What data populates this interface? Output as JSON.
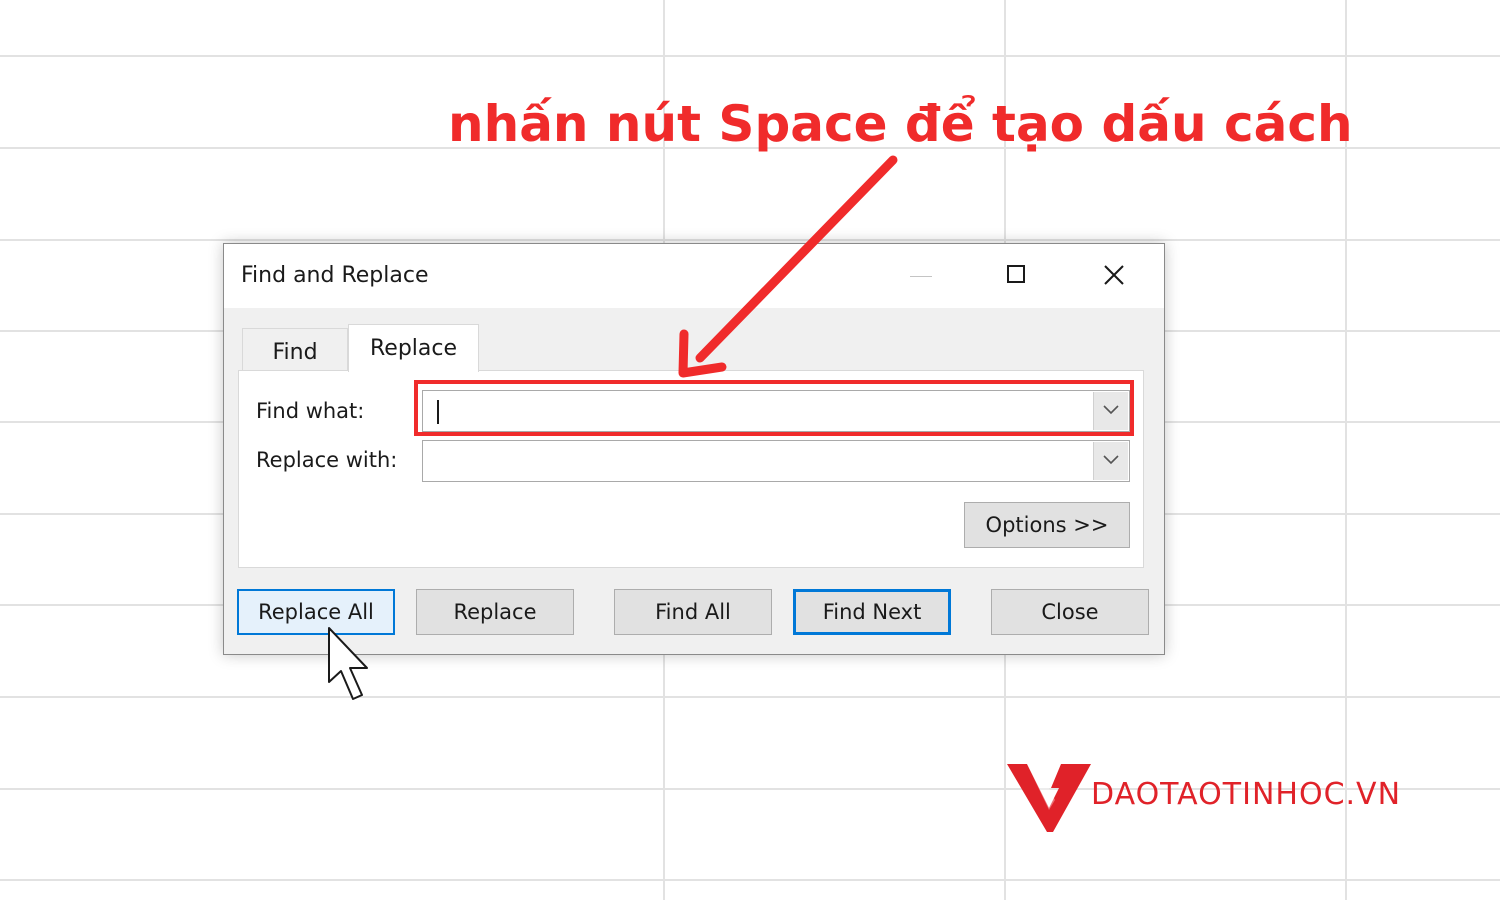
{
  "annotation": {
    "text": "nhấn nút Space để tạo dấu cách",
    "color": "#f02b2b"
  },
  "dialog": {
    "title": "Find and Replace",
    "titlebar_buttons": {
      "minimize_icon": "minimize-icon",
      "maximize_icon": "maximize-icon",
      "close_icon": "close-icon"
    },
    "tabs": [
      {
        "label": "Find",
        "selected": false
      },
      {
        "label": "Replace",
        "selected": true
      }
    ],
    "find_what": {
      "label": "Find what:",
      "value": ""
    },
    "replace_with": {
      "label": "Replace with:",
      "value": ""
    },
    "options_label": "Options >>",
    "buttons": {
      "replace_all": "Replace All",
      "replace": "Replace",
      "find_all": "Find All",
      "find_next": "Find Next",
      "close": "Close"
    }
  },
  "logo": {
    "text": "DAOTAOTINHOC.VN",
    "color": "#e02229"
  },
  "colors": {
    "highlight": "#f02b2b",
    "focus_blue": "#0078d7"
  }
}
